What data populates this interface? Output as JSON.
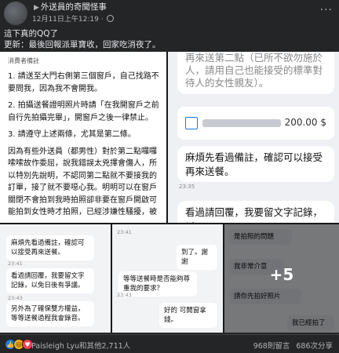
{
  "post": {
    "author": "外送員的奇聞怪事",
    "timestamp": "12月11日上午12:19",
    "text_line1": "這下真的QQ了",
    "text_line2": "更新：最後回報派單寶收，回家吃消夜了。"
  },
  "note": {
    "title": "消費者備註",
    "p1": "1. 請送至大門右側第三個窗戶，自己找路不要問我，因為我不會開我。",
    "p2": "2. 拍攝送餐證明照片時請「在我開窗戶之前自行先拍攝完畢」，開窗戶之後一律禁止。",
    "p3": "3. 請遵守上述兩條，尤其是第二條。",
    "p4": "因為有些外送員（都男性）對於第二點囉囉嗦嗦故作委屈，說我錯誤太兇擇會傷人，所以特別先說明，不認同第二點就不要接我的訂單，接了就不要噁心我。明明可以在窗戶關閉不會拍到我時拍照卻非要在窗戶開啟可能拍到女性時才拍照，已經涉嫌性騷擾，被"
  },
  "chat_top": {
    "cut_text": "再來送第二點（已所不欲勿施於人，請用自己也能接受的標準對待人的女性親友）。",
    "amount": "200.00 $",
    "bubble1": "麻煩先看過備註，確認可以接受再來送餐。",
    "time1": "23:35",
    "bubble2": "看過請回覆，我要留文字記錄，以"
  },
  "thumb1": {
    "m1": "麻煩先看過備註，確認可以接受再來送餐。",
    "m2": "看過請回覆，我要留文字記錄，以免日後有爭議。",
    "m3": "另外為了確保雙方權益，等等送餐過程我會錄音。",
    "ts1": "23:41",
    "ts2": "23:43"
  },
  "thumb2": {
    "r1": "到了。謝謝",
    "m1": "等等送餐時是否能夠尊重我的要求？",
    "r2": "好的 可開窗拿錢。",
    "ts1": "23:41",
    "ts2": "23:43"
  },
  "thumb3": {
    "m1": "是拍照的問題",
    "m2": "我非常介意",
    "m3": "請你先拍好照片",
    "m4": "我已經拍了",
    "more": "+5"
  },
  "footer": {
    "likers": "Paisleigh Lyu和其他2,711人",
    "comments": "968則留言",
    "shares": "686次分享"
  }
}
